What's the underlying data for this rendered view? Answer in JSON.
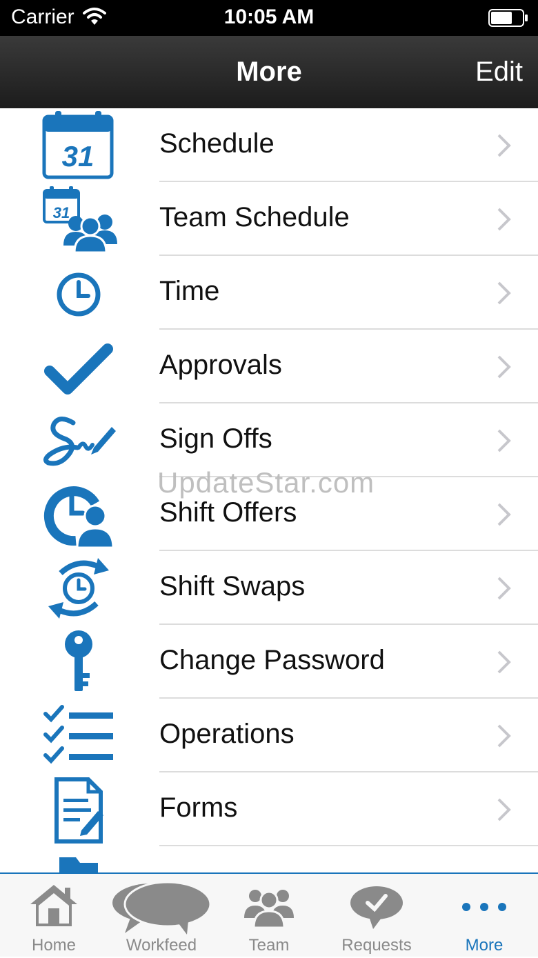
{
  "status_bar": {
    "carrier": "Carrier",
    "time": "10:05 AM"
  },
  "nav_bar": {
    "title": "More",
    "edit_label": "Edit"
  },
  "menu": [
    {
      "label": "Schedule",
      "icon": "calendar-icon"
    },
    {
      "label": "Team Schedule",
      "icon": "team-calendar-icon"
    },
    {
      "label": "Time",
      "icon": "clock-icon"
    },
    {
      "label": "Approvals",
      "icon": "checkmark-icon"
    },
    {
      "label": "Sign Offs",
      "icon": "signature-icon"
    },
    {
      "label": "Shift Offers",
      "icon": "shift-offer-icon"
    },
    {
      "label": "Shift Swaps",
      "icon": "shift-swap-icon"
    },
    {
      "label": "Change Password",
      "icon": "key-icon"
    },
    {
      "label": "Operations",
      "icon": "checklist-icon"
    },
    {
      "label": "Forms",
      "icon": "form-icon"
    }
  ],
  "calendar_day": "31",
  "watermark": "UpdateStar.com",
  "tabs": [
    {
      "label": "Home",
      "icon": "home-icon"
    },
    {
      "label": "Workfeed",
      "icon": "speech-bubbles-icon"
    },
    {
      "label": "Team",
      "icon": "team-icon"
    },
    {
      "label": "Requests",
      "icon": "request-check-icon"
    },
    {
      "label": "More",
      "icon": "more-dots-icon",
      "active": true
    }
  ],
  "colors": {
    "accent": "#1a75bb",
    "tab_inactive": "#8a8a8a",
    "nav_bar": "#2a2a2a"
  }
}
